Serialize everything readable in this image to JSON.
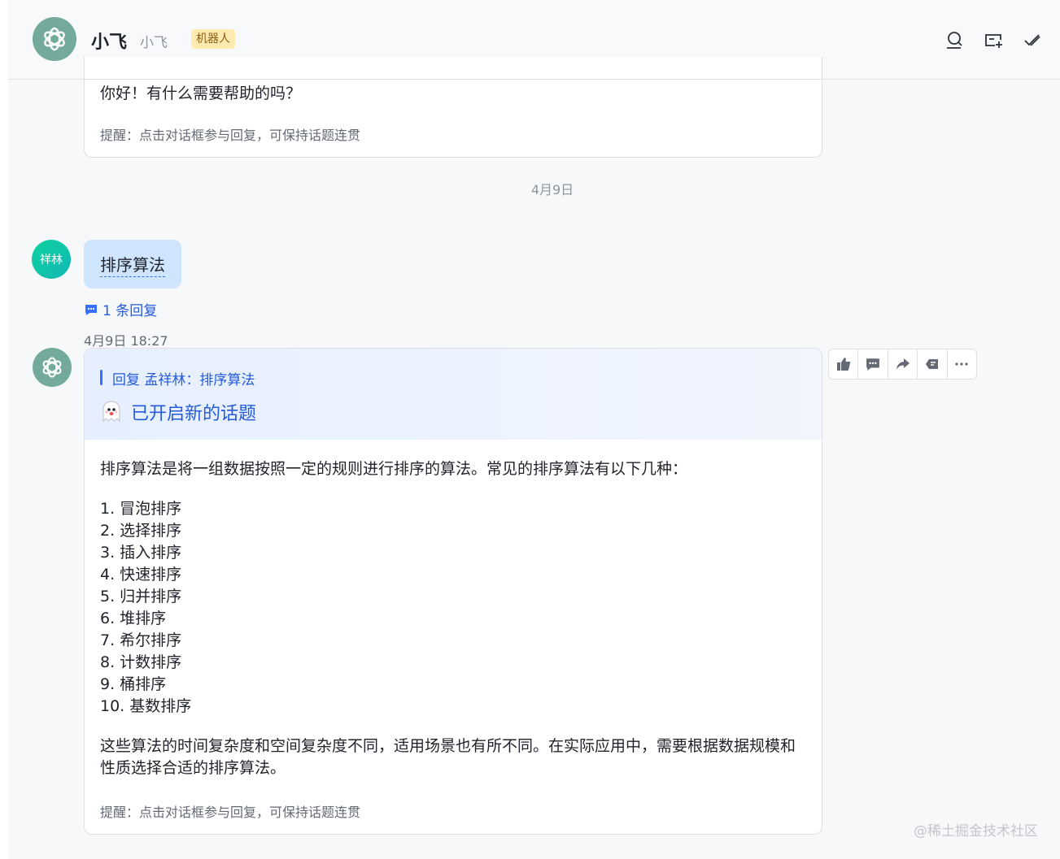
{
  "header": {
    "title": "小飞",
    "subtitle": "小飞",
    "badge": "机器人"
  },
  "messages": {
    "first_bot": {
      "text": "你好！有什么需要帮助的吗？",
      "hint": "提醒：点击对话框参与回复，可保持话题连贯"
    },
    "date_separator": "4月9日",
    "user": {
      "avatar_text": "祥林",
      "text": "排序算法",
      "reply_count": "1 条回复"
    },
    "timestamp": "4月9日 18:27",
    "bot_reply": {
      "quote": "回复 孟祥林：排序算法",
      "topic": "已开启新的话题",
      "intro": "排序算法是将一组数据按照一定的规则进行排序的算法。常见的排序算法有以下几种：",
      "list": [
        "1. 冒泡排序",
        "2. 选择排序",
        "3. 插入排序",
        "4. 快速排序",
        "5. 归并排序",
        "6. 堆排序",
        "7. 希尔排序",
        "8. 计数排序",
        "9. 桶排序",
        "10. 基数排序"
      ],
      "conclusion": "这些算法的时间复杂度和空间复杂度不同，适用场景也有所不同。在实际应用中，需要根据数据规模和性质选择合适的排序算法。",
      "hint": "提醒：点击对话框参与回复，可保持话题连贯"
    }
  },
  "watermark": "@稀土掘金技术社区",
  "colors": {
    "accent": "#3370ff",
    "link": "#245bdb",
    "bot_avatar": "#74aa9c",
    "user_avatar": "#11d3a0",
    "user_bubble": "#cfe4fd",
    "badge_bg": "#fdeab0"
  }
}
